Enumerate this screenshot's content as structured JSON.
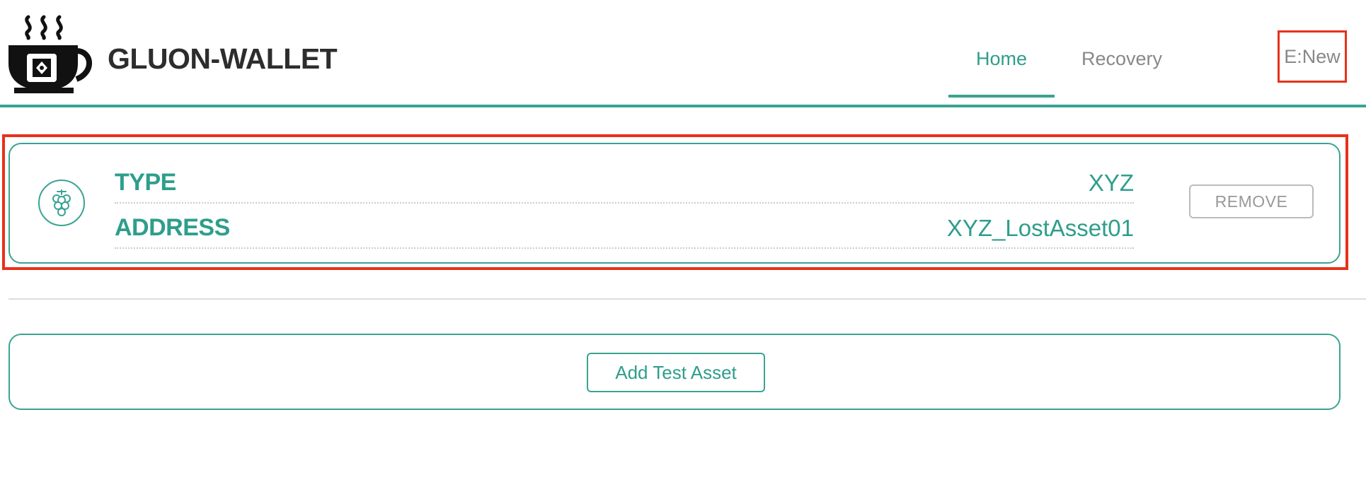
{
  "header": {
    "app_title": "GLUON-WALLET",
    "logo_icon": "steaming-cup-chip-icon",
    "nav": [
      {
        "label": "Home",
        "active": true
      },
      {
        "label": "Recovery",
        "active": false
      }
    ],
    "env_badge": "E:New"
  },
  "asset": {
    "icon": "grapes-icon",
    "rows": [
      {
        "label": "TYPE",
        "value": "XYZ"
      },
      {
        "label": "ADDRESS",
        "value": "XYZ_LostAsset01"
      }
    ],
    "remove_label": "REMOVE"
  },
  "add_asset": {
    "button_label": "Add Test Asset"
  },
  "colors": {
    "accent": "#3aa393",
    "highlight": "#e8311a",
    "muted": "#888888"
  }
}
